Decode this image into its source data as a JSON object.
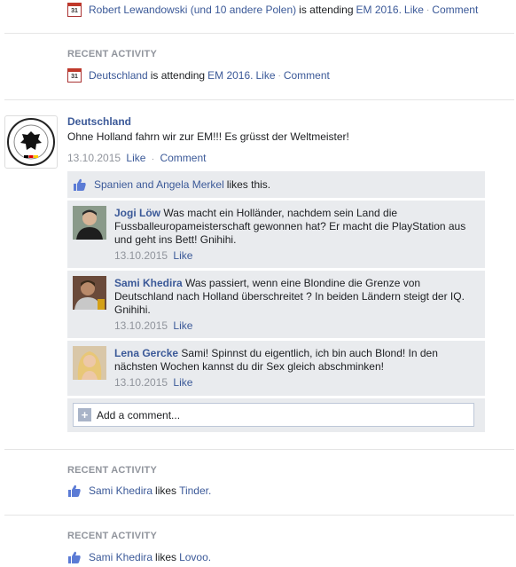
{
  "top_activity": {
    "subject": "Robert Lewandowski (und 10 andere Polen)",
    "verb": "is attending",
    "event": "EM 2016.",
    "like": "Like",
    "comment": "Comment",
    "calendar_day": "31"
  },
  "activity_1": {
    "label": "RECENT ACTIVITY",
    "subject": "Deutschland",
    "verb": "is attending",
    "event": "EM 2016.",
    "like": "Like",
    "comment": "Comment",
    "calendar_day": "31"
  },
  "post": {
    "author": "Deutschland",
    "text": "Ohne Holland fahrn wir zur EM!!! Es grüsst der Weltmeister!",
    "date": "13.10.2015",
    "like": "Like",
    "comment": "Comment",
    "likes_names": "Spanien and Angela Merkel",
    "likes_suffix": "likes this."
  },
  "comments": [
    {
      "name": "Jogi Löw",
      "text": "Was macht ein Holländer, nachdem sein Land die Fussballeuropameisterschaft gewonnen hat? Er macht die PlayStation aus und geht ins Bett! Gnihihi.",
      "date": "13.10.2015",
      "like": "Like"
    },
    {
      "name": "Sami Khedira",
      "text": "Was passiert, wenn eine Blondine die Grenze von Deutschland nach Holland überschreitet ? In beiden Ländern steigt der IQ. Gnihihi.",
      "date": "13.10.2015",
      "like": "Like"
    },
    {
      "name": "Lena Gercke",
      "text": "Sami! Spinnst du eigentlich, ich bin auch Blond! In den nächsten Wochen kannst du dir Sex gleich abschminken!",
      "date": "13.10.2015",
      "like": "Like"
    }
  ],
  "add_comment": {
    "placeholder": "Add a comment..."
  },
  "activity_2": {
    "label": "RECENT ACTIVITY",
    "subject": "Sami Khedira",
    "verb": "likes",
    "object": "Tinder."
  },
  "activity_3": {
    "label": "RECENT ACTIVITY",
    "subject": "Sami Khedira",
    "verb": "likes",
    "object": "Lovoo."
  },
  "icons": {
    "calendar": "calendar-icon",
    "like": "thumbs-up-icon",
    "plus": "plus-icon",
    "crest": "dfb-crest-icon"
  },
  "colors": {
    "link": "#3b5998",
    "muted": "#90949c",
    "panel": "#e9ebee"
  }
}
